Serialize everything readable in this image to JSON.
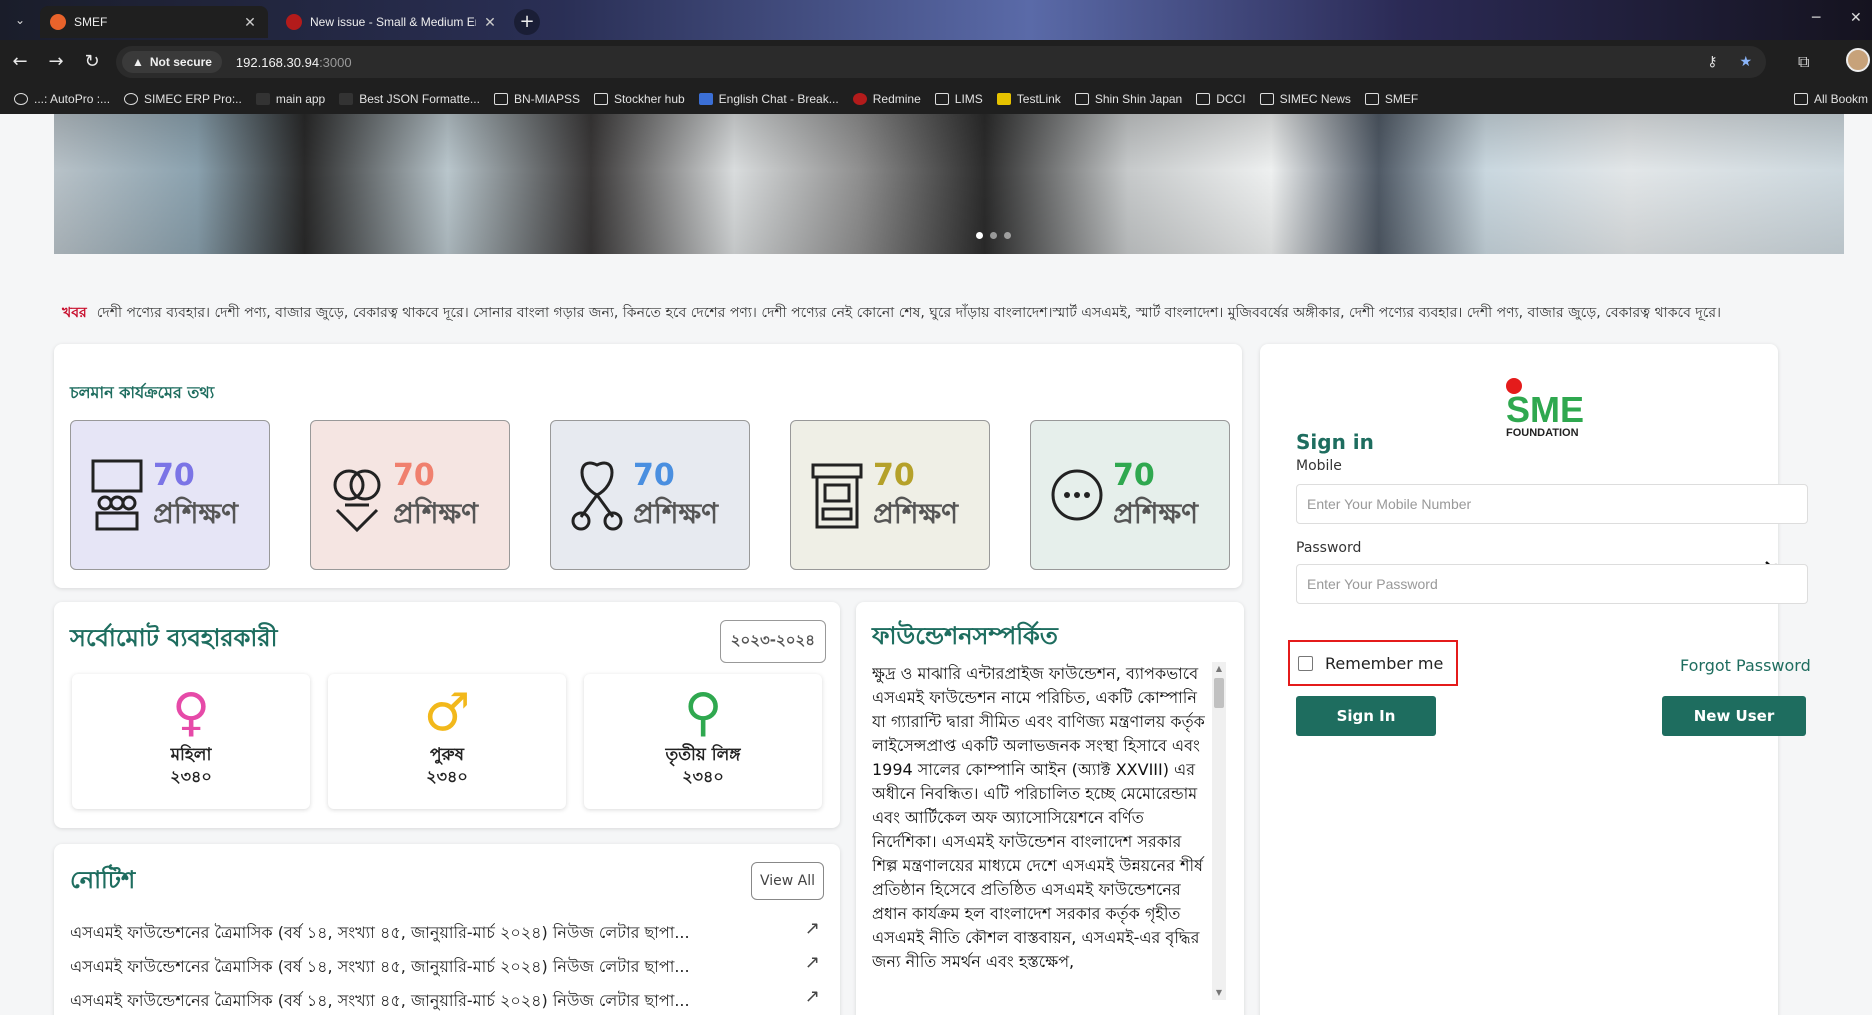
{
  "browser": {
    "tabs": [
      {
        "title": "SMEF",
        "active": true
      },
      {
        "title": "New issue - Small & Medium Er",
        "active": false
      }
    ],
    "security_label": "Not secure",
    "url_host": "192.168.30.94",
    "url_port": ":3000",
    "bookmarks": [
      "...: AutoPro :...",
      "SIMEC ERP Pro:..",
      "main app",
      "Best JSON Formatte...",
      "BN-MIAPSS",
      "Stockher hub",
      "English Chat - Break...",
      "Redmine",
      "LIMS",
      "TestLink",
      "Shin Shin Japan",
      "DCCI",
      "SIMEC News",
      "SMEF"
    ],
    "all_bookmarks": "All Bookm"
  },
  "news": {
    "label": "খবর",
    "text": "দেশী পণ্যের ব্যবহার। দেশী পণ্য, বাজার জুড়ে, বেকারত্ব থাকবে দূরে। সোনার বাংলা গড়ার জন্য, কিনতে হবে দেশের পণ্য। দেশী পণ্যের নেই কোনো শেষ, ঘুরে দাঁড়ায় বাংলাদেশ।স্মার্ট এসএমই, স্মার্ট বাংলাদেশ। মুজিববর্ষের অঙ্গীকার, দেশী পণ্যের ব্যবহার। দেশী পণ্য, বাজার জুড়ে, বেকারত্ব থাকবে দূরে।"
  },
  "ongoing": {
    "title": "চলমান কার্যক্রমের তথ্য",
    "items": [
      {
        "value": "70",
        "label": "প্রশিক্ষণ",
        "color": "#7b74e6",
        "bg": "#e6e5f6"
      },
      {
        "value": "70",
        "label": "প্রশিক্ষণ",
        "color": "#f0806e",
        "bg": "#f5e5e2"
      },
      {
        "value": "70",
        "label": "প্রশিক্ষণ",
        "color": "#4a8fe0",
        "bg": "#e7eaf0"
      },
      {
        "value": "70",
        "label": "প্রশিক্ষণ",
        "color": "#b5a12a",
        "bg": "#efefe6"
      },
      {
        "value": "70",
        "label": "প্রশিক্ষণ",
        "color": "#2fa84f",
        "bg": "#e6efeb"
      }
    ]
  },
  "users": {
    "title": "সর্বোমোট ব্যবহারকারী",
    "year": "২০২৩-২০২৪",
    "items": [
      {
        "symbol": "♀",
        "label": "মহিলা",
        "count": "২৩৪০",
        "color": "#e64aa8"
      },
      {
        "symbol": "♂",
        "label": "পুরুষ",
        "count": "২৩৪০",
        "color": "#f2b81b"
      },
      {
        "symbol": "⚲",
        "label": "তৃতীয় লিঙ্গ",
        "count": "২৩৪০",
        "color": "#2fa84f"
      }
    ]
  },
  "notice": {
    "title": "নোটিশ",
    "view_all": "View All",
    "items": [
      "এসএমই ফাউন্ডেশনের ত্রৈমাসিক (বর্ষ ১৪, সংখ্যা ৪৫, জানুয়ারি-মার্চ ২০২৪) নিউজ লেটার ছাপা...",
      "এসএমই ফাউন্ডেশনের ত্রৈমাসিক (বর্ষ ১৪, সংখ্যা ৪৫, জানুয়ারি-মার্চ ২০২৪) নিউজ লেটার ছাপা...",
      "এসএমই ফাউন্ডেশনের ত্রৈমাসিক (বর্ষ ১৪, সংখ্যা ৪৫, জানুয়ারি-মার্চ ২০২৪) নিউজ লেটার ছাপা..."
    ]
  },
  "about": {
    "title": "ফাউন্ডেশনসম্পর্কিত",
    "text": "ক্ষুদ্র ও মাঝারি এন্টারপ্রাইজ ফাউন্ডেশন, ব্যাপকভাবে এসএমই ফাউন্ডেশন নামে পরিচিত, একটি কোম্পানি যা গ্যারান্টি দ্বারা সীমিত এবং বাণিজ্য মন্ত্রণালয় কর্তৃক লাইসেন্সপ্রাপ্ত একটি অলাভজনক সংস্থা হিসাবে এবং 1994 সালের কোম্পানি আইন (অ্যাক্ট XXVIII) এর অধীনে নিবন্ধিত। এটি পরিচালিত হচ্ছে মেমোরেন্ডাম এবং আর্টিকেল অফ অ্যাসোসিয়েশনে বর্ণিত নির্দেশিকা। এসএমই ফাউন্ডেশন বাংলাদেশ সরকার শিল্প মন্ত্রণালয়ের মাধ্যমে দেশে এসএমই উন্নয়নের শীর্ষ প্রতিষ্ঠান হিসেবে প্রতিষ্ঠিত এসএমই ফাউন্ডেশনের প্রধান কার্যক্রম হল বাংলাদেশ সরকার কর্তৃক গৃহীত এসএমই নীতি কৌশল বাস্তবায়ন, এসএমই-এর বৃদ্ধির জন্য নীতি সমর্থন এবং হস্তক্ষেপ,"
  },
  "login": {
    "logo_text": "SME",
    "logo_sub": "FOUNDATION",
    "title": "Sign in",
    "mobile_label": "Mobile",
    "mobile_placeholder": "Enter Your Mobile Number",
    "password_label": "Password",
    "password_placeholder": "Enter Your Password",
    "remember": "Remember me",
    "forgot": "Forgot Password",
    "signin": "Sign In",
    "newuser": "New User"
  },
  "colors": {
    "brand": "#1e6d5f",
    "accent_red": "#c8102e"
  }
}
